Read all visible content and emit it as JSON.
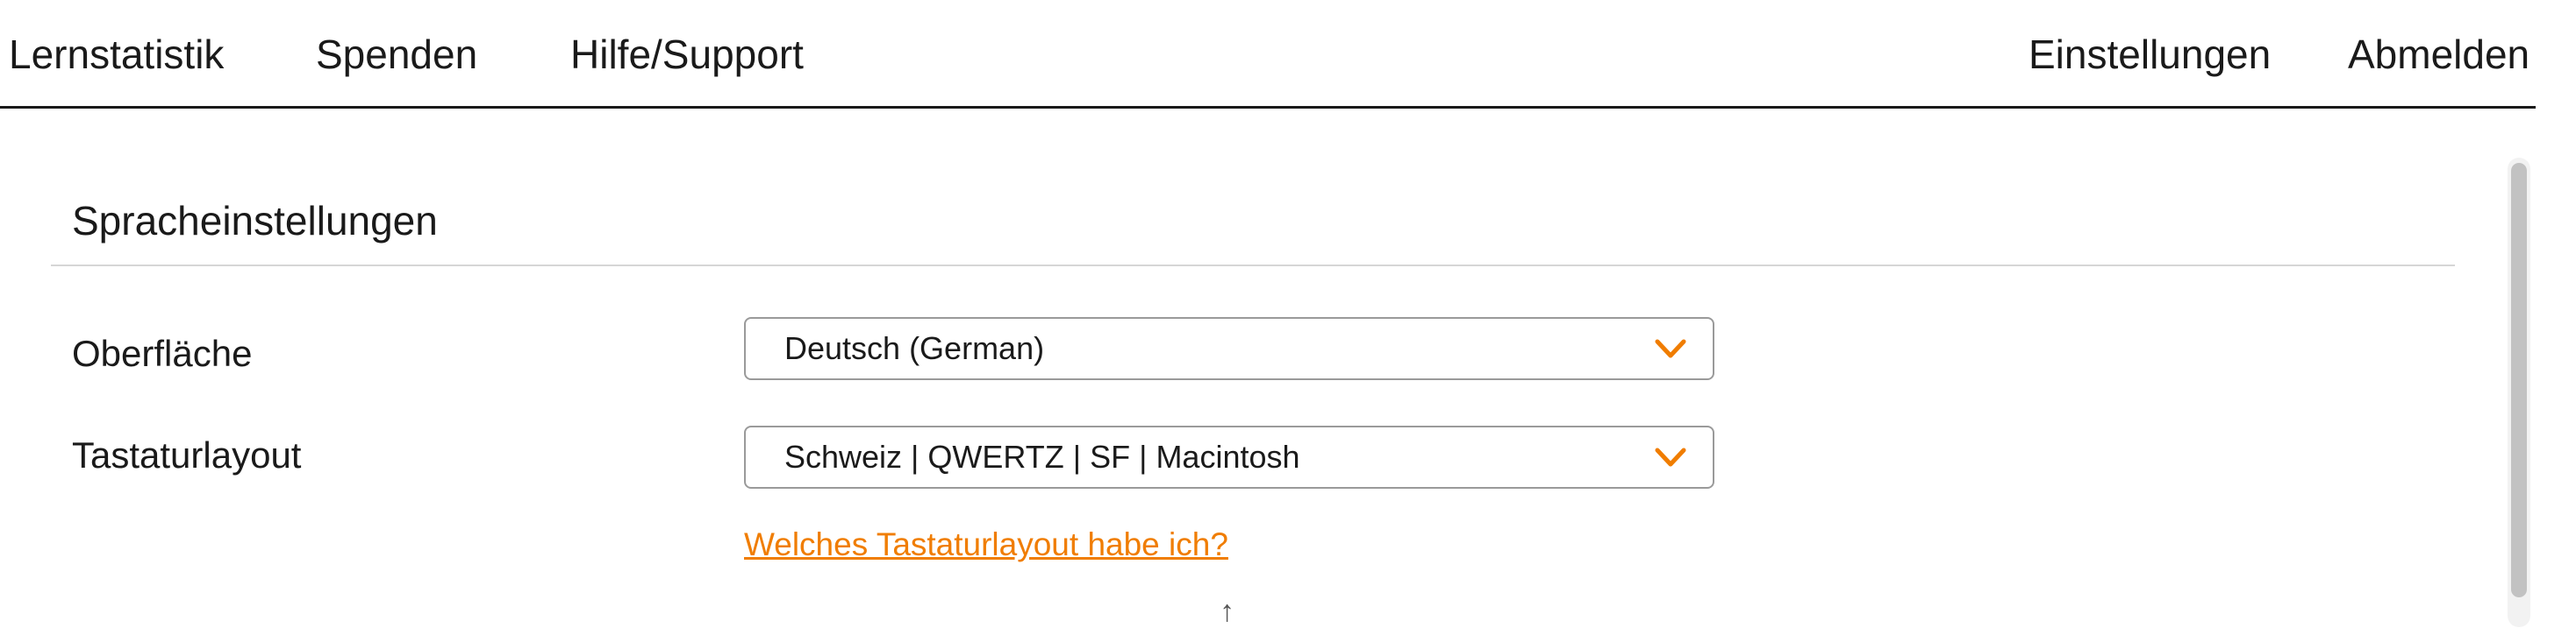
{
  "nav": {
    "left": [
      "Lernstatistik",
      "Spenden",
      "Hilfe/Support"
    ],
    "right": [
      "Einstellungen",
      "Abmelden"
    ]
  },
  "language_settings": {
    "title": "Spracheinstellungen",
    "interface_label": "Oberfläche",
    "interface_value": "Deutsch (German)",
    "keyboard_label": "Tastaturlayout",
    "keyboard_value": "Schweiz | QWERTZ | SF | Macintosh",
    "help_link": "Welches Tastaturlayout habe ich?"
  },
  "footer": {
    "arrow": "↑"
  },
  "colors": {
    "accent": "#f07d00",
    "text": "#1a1a1a",
    "border": "#9a9a9a"
  },
  "icons": {
    "dropdown": "chevron-down-icon"
  }
}
